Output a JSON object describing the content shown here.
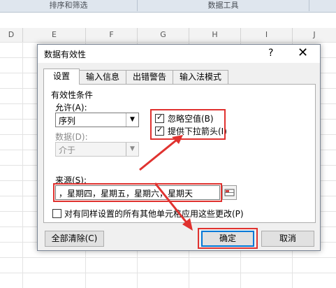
{
  "ribbon": {
    "groups": [
      "排序和筛选",
      "数据工具"
    ]
  },
  "sheet": {
    "columns": [
      "D",
      "E",
      "F",
      "G",
      "H",
      "I",
      "J"
    ]
  },
  "dialog": {
    "title": "数据有效性",
    "help": "?",
    "close": "✕",
    "tabs": [
      "设置",
      "输入信息",
      "出错警告",
      "输入法模式"
    ],
    "section_label": "有效性条件",
    "allow_label": "允许(A):",
    "allow_value": "序列",
    "data_label": "数据(D):",
    "data_value": "介于",
    "ignore_blank_label": "忽略空值(B)",
    "ignore_blank_checked": "☑",
    "dropdown_label": "提供下拉箭头(I)",
    "dropdown_checked": "☑",
    "source_label": "来源(S):",
    "source_value": "，星期四，星期五，星期六，星期天",
    "apply_all_label": "对有同样设置的所有其他单元格应用这些更改(P)",
    "clear_all": "全部清除(C)",
    "ok": "确定",
    "cancel": "取消"
  },
  "colors": {
    "highlight": "#e0322f",
    "default_button_border": "#0078d7"
  }
}
